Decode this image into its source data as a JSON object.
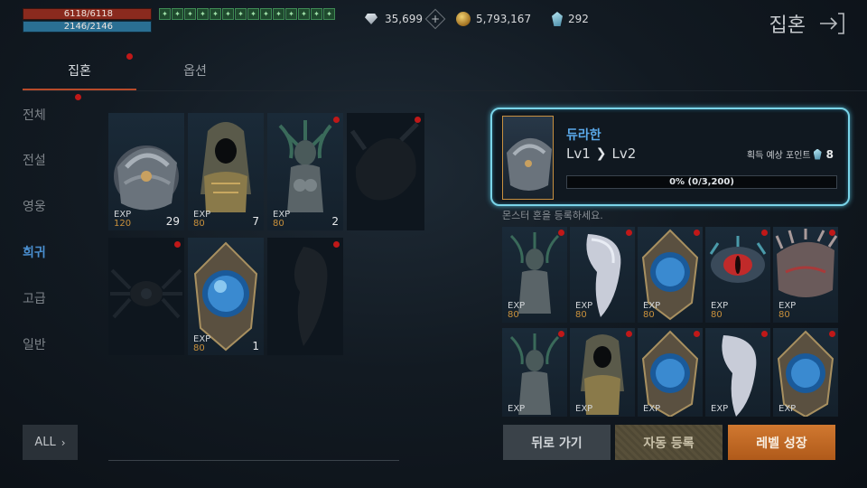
{
  "status": {
    "hp": "6118/6118",
    "mp": "2146/2146",
    "hp_fraction": 1.0,
    "mp_fraction": 1.0
  },
  "buffs": [
    "buff-icon",
    "buff-icon",
    "buff-icon",
    "buff-icon",
    "buff-icon",
    "buff-icon",
    "buff-icon",
    "buff-icon",
    "buff-icon",
    "buff-icon",
    "buff-icon",
    "buff-icon",
    "buff-icon",
    "buff-icon"
  ],
  "currency": {
    "diamond": "35,699",
    "gold": "5,793,167",
    "gem": "292"
  },
  "header": {
    "title": "집혼"
  },
  "tabs": [
    {
      "label": "집혼"
    },
    {
      "label": "옵션"
    }
  ],
  "categories": [
    {
      "label": "전체"
    },
    {
      "label": "전설"
    },
    {
      "label": "영웅"
    },
    {
      "label": "희귀"
    },
    {
      "label": "고급"
    },
    {
      "label": "일반"
    }
  ],
  "grid": [
    {
      "exp_label": "EXP",
      "exp": "120",
      "count": "29",
      "icon": "armored-knight"
    },
    {
      "exp_label": "EXP",
      "exp": "80",
      "count": "7",
      "icon": "hooded-figure"
    },
    {
      "exp_label": "EXP",
      "exp": "80",
      "count": "2",
      "icon": "medusa"
    },
    {
      "exp_label": "",
      "exp": "",
      "count": "",
      "icon": "dark-beast"
    },
    {
      "exp_label": "",
      "exp": "",
      "count": "",
      "icon": "spider-creature"
    },
    {
      "exp_label": "EXP",
      "exp": "80",
      "count": "1",
      "icon": "blue-orb-crest"
    },
    {
      "exp_label": "",
      "exp": "",
      "count": "",
      "icon": "white-serpent"
    }
  ],
  "all_button": {
    "label": "ALL"
  },
  "detail": {
    "name": "듀라한",
    "lv_from": "Lv1",
    "lv_to": "Lv2",
    "points_label": "획득 예상 포인트",
    "points": "8",
    "progress": "0% (0/3,200)",
    "progress_fraction": 0
  },
  "hint": "몬스터 혼을 등록하세요.",
  "slots": [
    {
      "exp_label": "EXP",
      "exp": "80",
      "icon": "medusa"
    },
    {
      "exp_label": "EXP",
      "exp": "80",
      "icon": "white-serpent"
    },
    {
      "exp_label": "EXP",
      "exp": "80",
      "icon": "blue-orb-crest"
    },
    {
      "exp_label": "EXP",
      "exp": "80",
      "icon": "eye-creature"
    },
    {
      "exp_label": "EXP",
      "exp": "80",
      "icon": "spiked-beast"
    },
    {
      "exp_label": "EXP",
      "exp": "",
      "icon": "medusa"
    },
    {
      "exp_label": "EXP",
      "exp": "",
      "icon": "hooded-figure"
    },
    {
      "exp_label": "EXP",
      "exp": "",
      "icon": "blue-orb-crest"
    },
    {
      "exp_label": "EXP",
      "exp": "",
      "icon": "white-serpent"
    },
    {
      "exp_label": "EXP",
      "exp": "",
      "icon": "blue-orb-crest"
    }
  ],
  "buttons": {
    "back": "뒤로 가기",
    "auto": "자동 등록",
    "grow": "레벨 성장"
  },
  "colors": {
    "accent": "#7ad4e8",
    "rare": "#4a8fd0",
    "level_up": "#d07830",
    "hp": "#8a2a1e",
    "mp": "#2a6f93",
    "notify": "#c01818"
  }
}
